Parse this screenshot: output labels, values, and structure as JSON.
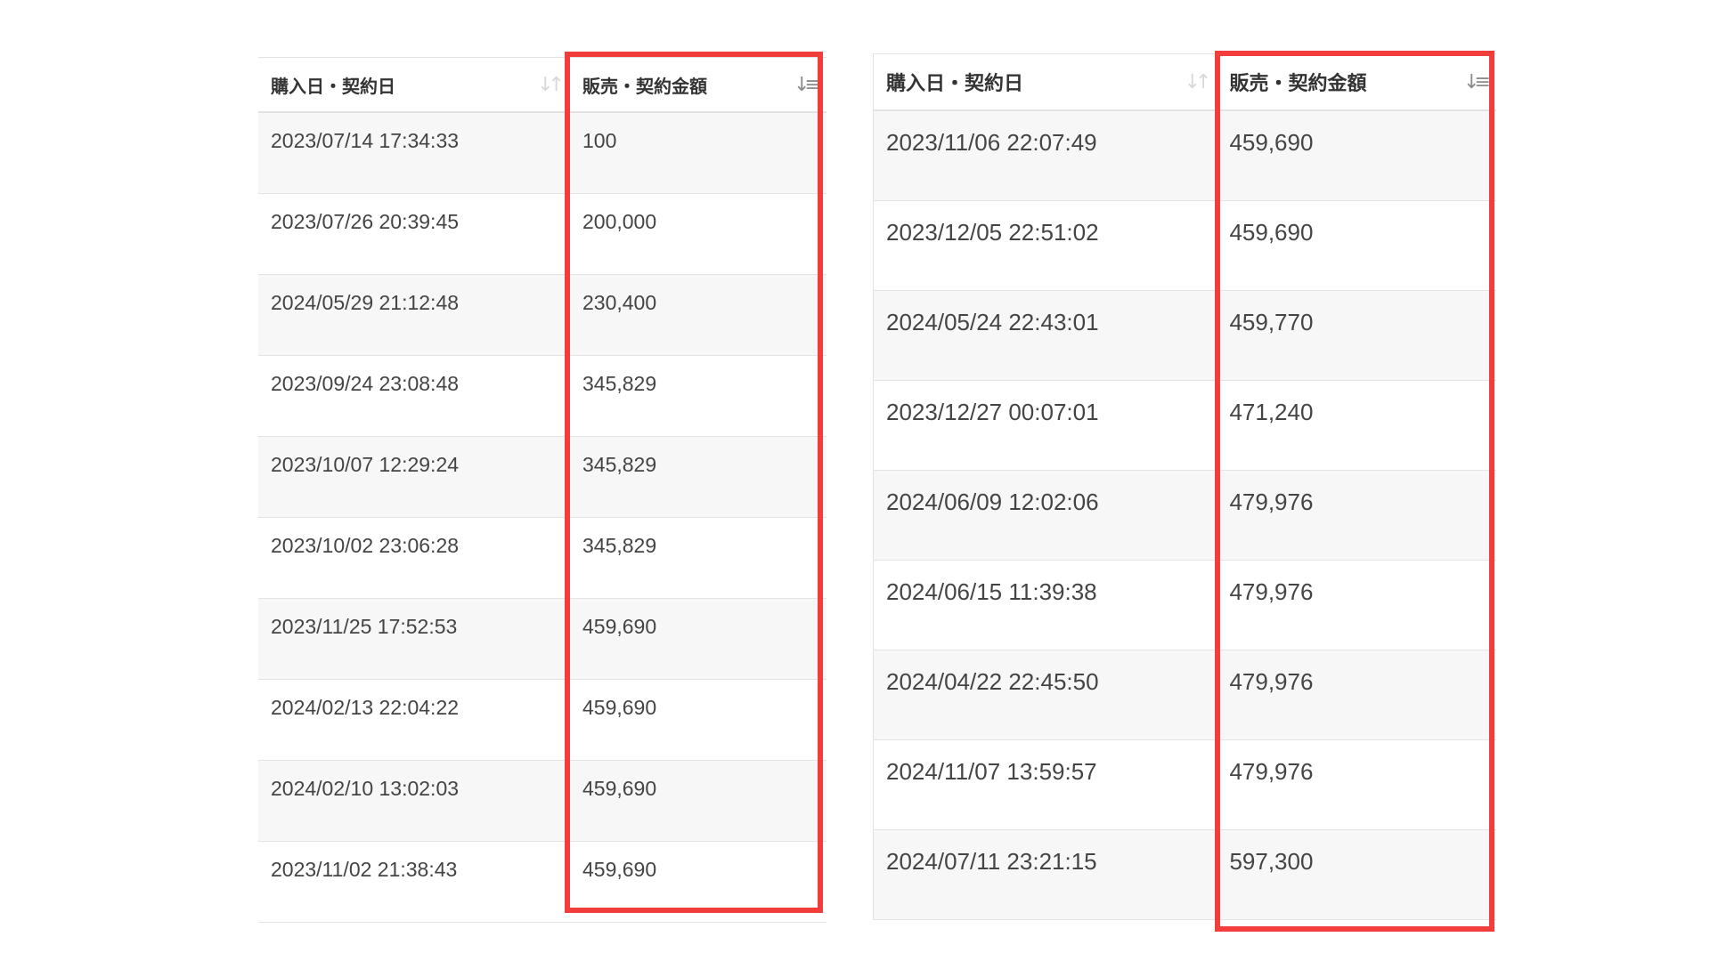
{
  "tables": [
    {
      "header": {
        "date": "購入日・契約日",
        "amount": "販売・契約金額"
      },
      "rows": [
        {
          "date": "2023/07/14 17:34:33",
          "amount": "100"
        },
        {
          "date": "2023/07/26 20:39:45",
          "amount": "200,000"
        },
        {
          "date": "2024/05/29 21:12:48",
          "amount": "230,400"
        },
        {
          "date": "2023/09/24 23:08:48",
          "amount": "345,829"
        },
        {
          "date": "2023/10/07 12:29:24",
          "amount": "345,829"
        },
        {
          "date": "2023/10/02 23:06:28",
          "amount": "345,829"
        },
        {
          "date": "2023/11/25 17:52:53",
          "amount": "459,690"
        },
        {
          "date": "2024/02/13 22:04:22",
          "amount": "459,690"
        },
        {
          "date": "2024/02/10 13:02:03",
          "amount": "459,690"
        },
        {
          "date": "2023/11/02 21:38:43",
          "amount": "459,690"
        }
      ]
    },
    {
      "header": {
        "date": "購入日・契約日",
        "amount": "販売・契約金額"
      },
      "rows": [
        {
          "date": "2023/11/06 22:07:49",
          "amount": "459,690"
        },
        {
          "date": "2023/12/05 22:51:02",
          "amount": "459,690"
        },
        {
          "date": "2024/05/24 22:43:01",
          "amount": "459,770"
        },
        {
          "date": "2023/12/27 00:07:01",
          "amount": "471,240"
        },
        {
          "date": "2024/06/09 12:02:06",
          "amount": "479,976"
        },
        {
          "date": "2024/06/15 11:39:38",
          "amount": "479,976"
        },
        {
          "date": "2024/04/22 22:45:50",
          "amount": "479,976"
        },
        {
          "date": "2024/11/07 13:59:57",
          "amount": "479,976"
        },
        {
          "date": "2024/07/11 23:21:15",
          "amount": "597,300"
        }
      ]
    }
  ],
  "icons": {
    "sort_inactive": "sort-icon",
    "sort_active": "sort-ascending-icon"
  },
  "colors": {
    "highlight": "#f23d3d",
    "row_alt": "#f7f7f7",
    "border": "#e2e2e2"
  }
}
